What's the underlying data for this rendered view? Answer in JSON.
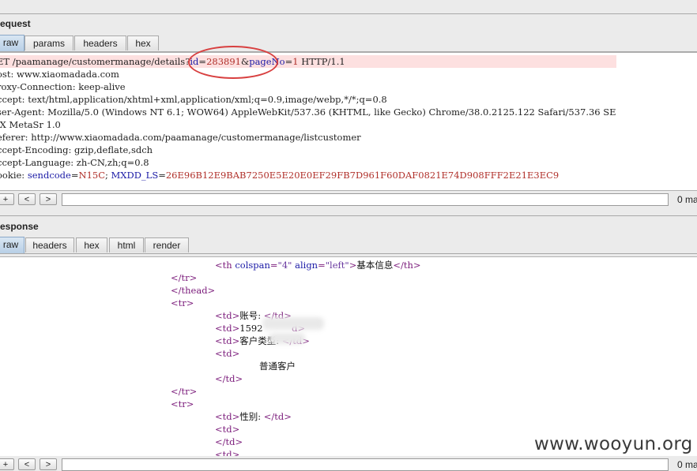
{
  "request": {
    "title": "equest",
    "tabs": [
      "raw",
      "params",
      "headers",
      "hex"
    ],
    "lines": [
      [
        [
          "m",
          "ET /paamanage/customermanage/details?"
        ],
        [
          "p",
          "id"
        ],
        [
          "m",
          "="
        ],
        [
          "v",
          "283891"
        ],
        [
          "m",
          "&"
        ],
        [
          "p",
          "pageNo"
        ],
        [
          "m",
          "="
        ],
        [
          "v",
          "1"
        ],
        [
          "m",
          " HTTP/1.1"
        ]
      ],
      [
        [
          "m",
          "ost: www.xiaomadada.com"
        ]
      ],
      [
        [
          "m",
          "roxy-Connection: keep-alive"
        ]
      ],
      [
        [
          "m",
          "ccept: text/html,application/xhtml+xml,application/xml;q=0.9,image/webp,*/*;q=0.8"
        ]
      ],
      [
        [
          "m",
          "ser-Agent: Mozilla/5.0 (Windows NT 6.1; WOW64) AppleWebKit/537.36 (KHTML, like Gecko) Chrome/38.0.2125.122 Safari/537.36 SE"
        ]
      ],
      [
        [
          "m",
          ".X MetaSr 1.0"
        ]
      ],
      [
        [
          "m",
          "eferer: http://www.xiaomadada.com/paamanage/customermanage/listcustomer"
        ]
      ],
      [
        [
          "m",
          "ccept-Encoding: gzip,deflate,sdch"
        ]
      ],
      [
        [
          "m",
          "ccept-Language: zh-CN,zh;q=0.8"
        ]
      ],
      [
        [
          "m",
          "ookie: "
        ],
        [
          "p",
          "sendcode"
        ],
        [
          "m",
          "="
        ],
        [
          "v",
          "N15C"
        ],
        [
          "m",
          "; "
        ],
        [
          "p",
          "MXDD_LS"
        ],
        [
          "m",
          "="
        ],
        [
          "v",
          "26E96B12E9BAB7250E5E20E0EF29FB7D961F60DAF0821E74D908FFF2E21E3EC9"
        ]
      ]
    ],
    "search": {
      "btn_plus": "+",
      "btn_prev": "<",
      "btn_next": ">",
      "matches": "0 ma"
    }
  },
  "response": {
    "title": "esponse",
    "tabs": [
      "raw",
      "headers",
      "hex",
      "html",
      "render"
    ],
    "lines": [
      {
        "indent": 272,
        "parts": [
          [
            "tag",
            "<th "
          ],
          [
            "attr",
            "colspan"
          ],
          [
            "tag",
            "="
          ],
          [
            "aval",
            "\"4\""
          ],
          [
            "tag",
            " "
          ],
          [
            "attr",
            "align"
          ],
          [
            "tag",
            "="
          ],
          [
            "aval",
            "\"left\""
          ],
          [
            "tag",
            ">"
          ],
          [
            "txt",
            "基本信息"
          ],
          [
            "tag",
            "</th>"
          ]
        ]
      },
      {
        "indent": 216,
        "parts": [
          [
            "tag",
            "</tr>"
          ]
        ]
      },
      {
        "indent": 216,
        "parts": [
          [
            "tag",
            "</thead>"
          ]
        ]
      },
      {
        "indent": 216,
        "parts": [
          [
            "tag",
            "<tr>"
          ]
        ]
      },
      {
        "indent": 272,
        "parts": [
          [
            "tag",
            "<td>"
          ],
          [
            "txt",
            "账号: "
          ],
          [
            "tag",
            "</td>"
          ]
        ]
      },
      {
        "indent": 272,
        "parts": [
          [
            "tag",
            "<td>"
          ],
          [
            "txt",
            "1592"
          ],
          [
            "txt",
            "          "
          ],
          [
            "tag",
            "d>"
          ]
        ]
      },
      {
        "indent": 272,
        "parts": [
          [
            "tag",
            "<td>"
          ],
          [
            "txt",
            "客户类型: "
          ],
          [
            "tag",
            "</td>"
          ]
        ]
      },
      {
        "indent": 272,
        "parts": [
          [
            "tag",
            "<td>"
          ]
        ]
      },
      {
        "indent": 328,
        "parts": [
          [
            "txt",
            "普通客户"
          ]
        ]
      },
      {
        "indent": 272,
        "parts": [
          [
            "tag",
            "</td>"
          ]
        ]
      },
      {
        "indent": 216,
        "parts": [
          [
            "tag",
            "</tr>"
          ]
        ]
      },
      {
        "indent": 216,
        "parts": [
          [
            "tag",
            "<tr>"
          ]
        ]
      },
      {
        "indent": 272,
        "parts": [
          [
            "tag",
            "<td>"
          ],
          [
            "txt",
            "性别: "
          ],
          [
            "tag",
            "</td>"
          ]
        ]
      },
      {
        "indent": 272,
        "parts": [
          [
            "tag",
            "<td>"
          ]
        ]
      },
      {
        "indent": 272,
        "parts": [
          [
            "tag",
            "</td>"
          ]
        ]
      },
      {
        "indent": 272,
        "parts": [
          [
            "tag",
            "<td>"
          ]
        ]
      }
    ],
    "search": {
      "btn_plus": "+",
      "btn_prev": "<",
      "btn_next": ">",
      "matches": "0 ma"
    }
  },
  "watermark": "www.wooyun.org"
}
